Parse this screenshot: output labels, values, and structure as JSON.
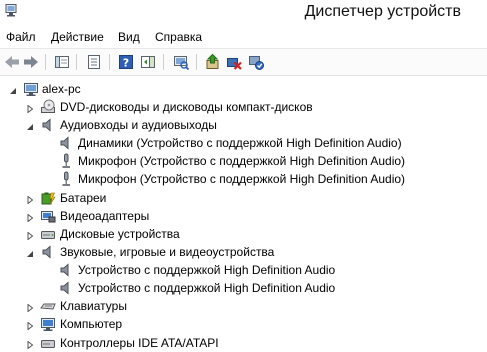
{
  "window": {
    "title": "Диспетчер устройств"
  },
  "menu": [
    "Файл",
    "Действие",
    "Вид",
    "Справка"
  ],
  "tree": {
    "root": "alex-pc",
    "categories": [
      {
        "label": "DVD-дисководы и дисководы компакт-дисков",
        "icon": "dvd-drive-icon",
        "expanded": false,
        "children": []
      },
      {
        "label": "Аудиовходы и аудиовыходы",
        "icon": "speaker-icon",
        "expanded": true,
        "children": [
          {
            "label": "Динамики (Устройство с поддержкой High Definition Audio)",
            "icon": "speaker-icon"
          },
          {
            "label": "Микрофон (Устройство с поддержкой High Definition Audio)",
            "icon": "microphone-icon"
          },
          {
            "label": "Микрофон (Устройство с поддержкой High Definition Audio)",
            "icon": "microphone-icon"
          }
        ]
      },
      {
        "label": "Батареи",
        "icon": "battery-icon",
        "expanded": false,
        "children": []
      },
      {
        "label": "Видеоадаптеры",
        "icon": "display-adapter-icon",
        "expanded": false,
        "children": []
      },
      {
        "label": "Дисковые устройства",
        "icon": "disk-drive-icon",
        "expanded": false,
        "children": []
      },
      {
        "label": "Звуковые, игровые и видеоустройства",
        "icon": "speaker-icon",
        "expanded": true,
        "children": [
          {
            "label": "Устройство с поддержкой High Definition Audio",
            "icon": "speaker-icon"
          },
          {
            "label": "Устройство с поддержкой High Definition Audio",
            "icon": "speaker-icon"
          }
        ]
      },
      {
        "label": "Клавиатуры",
        "icon": "keyboard-icon",
        "expanded": false,
        "children": []
      },
      {
        "label": "Компьютер",
        "icon": "computer-icon",
        "expanded": false,
        "children": []
      },
      {
        "label": "Контроллеры IDE ATA/ATAPI",
        "icon": "ide-controller-icon",
        "expanded": false,
        "children": []
      }
    ]
  },
  "colors": {
    "accent": "#1c5fb8",
    "toolbar_bg": "#fbfbfb",
    "tree_line": "#7a7a7a"
  }
}
